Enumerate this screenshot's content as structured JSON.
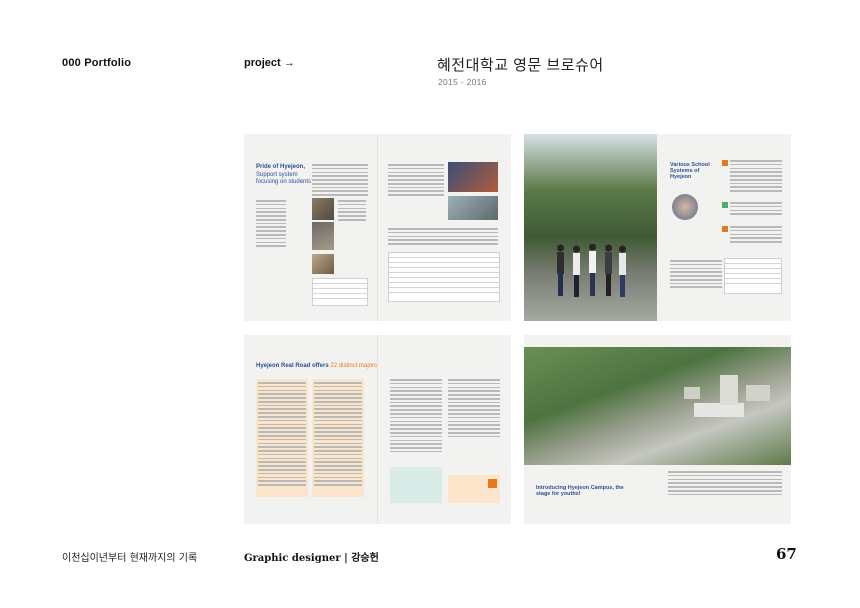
{
  "header": {
    "portfolio": "000 Portfolio",
    "project": "project →",
    "title": "혜전대학교  영문 브로슈어",
    "years": "2015 - 2016"
  },
  "spreads": [
    {
      "headline": "Pride of Hyejeon,",
      "subhead": "Support system focusing on students"
    },
    {
      "headline": "Various School Systems of Hyejeon"
    },
    {
      "headline": "Hyejeon Real Road offers",
      "subhead": "22 distinct majors"
    },
    {
      "headline": "Introducing Hyejeon Campus, the stage for youths!"
    }
  ],
  "footer": {
    "left": "이천십이년부터 현재까지의 기록",
    "designer": "Graphic designer | 강승헌",
    "page_number": "67"
  },
  "colors": {
    "brand_blue": "#2e4e9c",
    "accent_orange": "#e8781e",
    "page_bg": "#ffffff",
    "spread_bg": "#f2f2f0"
  }
}
